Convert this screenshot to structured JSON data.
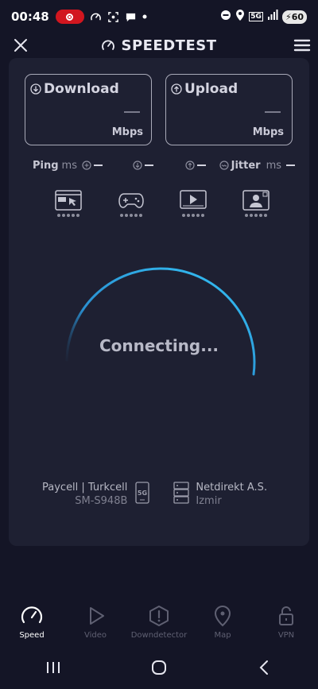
{
  "status_bar": {
    "time": "00:48",
    "battery": "60",
    "network": "5G"
  },
  "header": {
    "brand": "SPEEDTEST"
  },
  "metrics": {
    "download": {
      "label": "Download",
      "value": "—",
      "unit": "Mbps"
    },
    "upload": {
      "label": "Upload",
      "value": "—",
      "unit": "Mbps"
    }
  },
  "ping": {
    "label": "Ping",
    "unit": "ms",
    "jitter_label": "Jitter",
    "jitter_unit": "ms"
  },
  "app_icons": [
    "browser-icon",
    "gamepad-icon",
    "video-player-icon",
    "video-call-icon"
  ],
  "gauge": {
    "status": "Connecting...",
    "accent_color": "#29b6f6"
  },
  "provider": {
    "name": "Paycell | Turkcell",
    "device": "SM-S948B",
    "network_badge": "5G"
  },
  "server": {
    "name": "Netdirekt A.S.",
    "location": "Izmir"
  },
  "bottom_nav": [
    {
      "label": "Speed",
      "icon": "speedometer-icon",
      "active": true
    },
    {
      "label": "Video",
      "icon": "play-icon",
      "active": false
    },
    {
      "label": "Downdetector",
      "icon": "alert-icon",
      "active": false
    },
    {
      "label": "Map",
      "icon": "map-pin-icon",
      "active": false
    },
    {
      "label": "VPN",
      "icon": "lock-icon",
      "active": false
    }
  ]
}
